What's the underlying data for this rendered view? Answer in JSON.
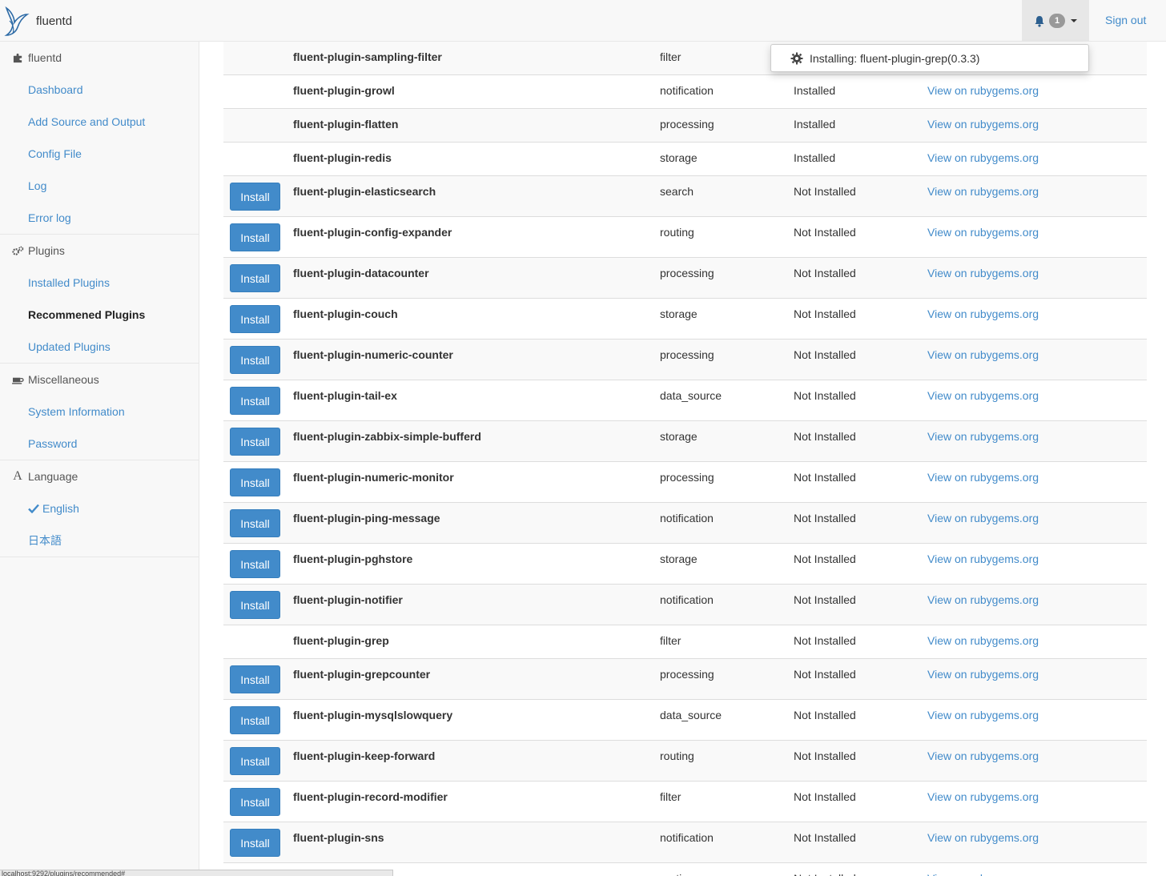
{
  "brand": {
    "name": "fluentd"
  },
  "navbar": {
    "notification_count": "1",
    "signout_label": "Sign out"
  },
  "notification": {
    "text": "Installing: fluent-plugin-grep(0.3.3)"
  },
  "sidebar": {
    "sections": [
      {
        "title": "fluentd",
        "icon": "puzzle-icon",
        "items": [
          {
            "label": "Dashboard"
          },
          {
            "label": "Add Source and Output"
          },
          {
            "label": "Config File"
          },
          {
            "label": "Log"
          },
          {
            "label": "Error log"
          }
        ]
      },
      {
        "title": "Plugins",
        "icon": "cogs-icon",
        "items": [
          {
            "label": "Installed Plugins"
          },
          {
            "label": "Recommened Plugins",
            "active": true
          },
          {
            "label": "Updated Plugins"
          }
        ]
      },
      {
        "title": "Miscellaneous",
        "icon": "coffee-icon",
        "items": [
          {
            "label": "System Information"
          },
          {
            "label": "Password"
          }
        ]
      },
      {
        "title": "Language",
        "icon": "font-icon",
        "items": [
          {
            "label": "English",
            "checked": true
          },
          {
            "label": "日本語"
          }
        ]
      }
    ]
  },
  "table": {
    "install_label": "Install",
    "link_label": "View on rubygems.org",
    "rows": [
      {
        "name": "fluent-plugin-sampling-filter",
        "category": "filter",
        "status": "",
        "link": "",
        "install": false
      },
      {
        "name": "fluent-plugin-growl",
        "category": "notification",
        "status": "Installed",
        "link": "View on rubygems.org",
        "install": false
      },
      {
        "name": "fluent-plugin-flatten",
        "category": "processing",
        "status": "Installed",
        "link": "View on rubygems.org",
        "install": false
      },
      {
        "name": "fluent-plugin-redis",
        "category": "storage",
        "status": "Installed",
        "link": "View on rubygems.org",
        "install": false
      },
      {
        "name": "fluent-plugin-elasticsearch",
        "category": "search",
        "status": "Not Installed",
        "link": "View on rubygems.org",
        "install": true
      },
      {
        "name": "fluent-plugin-config-expander",
        "category": "routing",
        "status": "Not Installed",
        "link": "View on rubygems.org",
        "install": true
      },
      {
        "name": "fluent-plugin-datacounter",
        "category": "processing",
        "status": "Not Installed",
        "link": "View on rubygems.org",
        "install": true
      },
      {
        "name": "fluent-plugin-couch",
        "category": "storage",
        "status": "Not Installed",
        "link": "View on rubygems.org",
        "install": true
      },
      {
        "name": "fluent-plugin-numeric-counter",
        "category": "processing",
        "status": "Not Installed",
        "link": "View on rubygems.org",
        "install": true
      },
      {
        "name": "fluent-plugin-tail-ex",
        "category": "data_source",
        "status": "Not Installed",
        "link": "View on rubygems.org",
        "install": true
      },
      {
        "name": "fluent-plugin-zabbix-simple-bufferd",
        "category": "storage",
        "status": "Not Installed",
        "link": "View on rubygems.org",
        "install": true
      },
      {
        "name": "fluent-plugin-numeric-monitor",
        "category": "processing",
        "status": "Not Installed",
        "link": "View on rubygems.org",
        "install": true
      },
      {
        "name": "fluent-plugin-ping-message",
        "category": "notification",
        "status": "Not Installed",
        "link": "View on rubygems.org",
        "install": true
      },
      {
        "name": "fluent-plugin-pghstore",
        "category": "storage",
        "status": "Not Installed",
        "link": "View on rubygems.org",
        "install": true
      },
      {
        "name": "fluent-plugin-notifier",
        "category": "notification",
        "status": "Not Installed",
        "link": "View on rubygems.org",
        "install": true
      },
      {
        "name": "fluent-plugin-grep",
        "category": "filter",
        "status": "Not Installed",
        "link": "View on rubygems.org",
        "install": false
      },
      {
        "name": "fluent-plugin-grepcounter",
        "category": "processing",
        "status": "Not Installed",
        "link": "View on rubygems.org",
        "install": true
      },
      {
        "name": "fluent-plugin-mysqlslowquery",
        "category": "data_source",
        "status": "Not Installed",
        "link": "View on rubygems.org",
        "install": true
      },
      {
        "name": "fluent-plugin-keep-forward",
        "category": "routing",
        "status": "Not Installed",
        "link": "View on rubygems.org",
        "install": true
      },
      {
        "name": "fluent-plugin-record-modifier",
        "category": "filter",
        "status": "Not Installed",
        "link": "View on rubygems.org",
        "install": true
      },
      {
        "name": "fluent-plugin-sns",
        "category": "notification",
        "status": "Not Installed",
        "link": "View on rubygems.org",
        "install": true
      },
      {
        "name": "",
        "category": "routing",
        "status": "Not Installed",
        "link": "View on rubygems.org",
        "install": true
      }
    ]
  },
  "statusbar": {
    "text": "localhost:9292/plugins/recommended#"
  }
}
